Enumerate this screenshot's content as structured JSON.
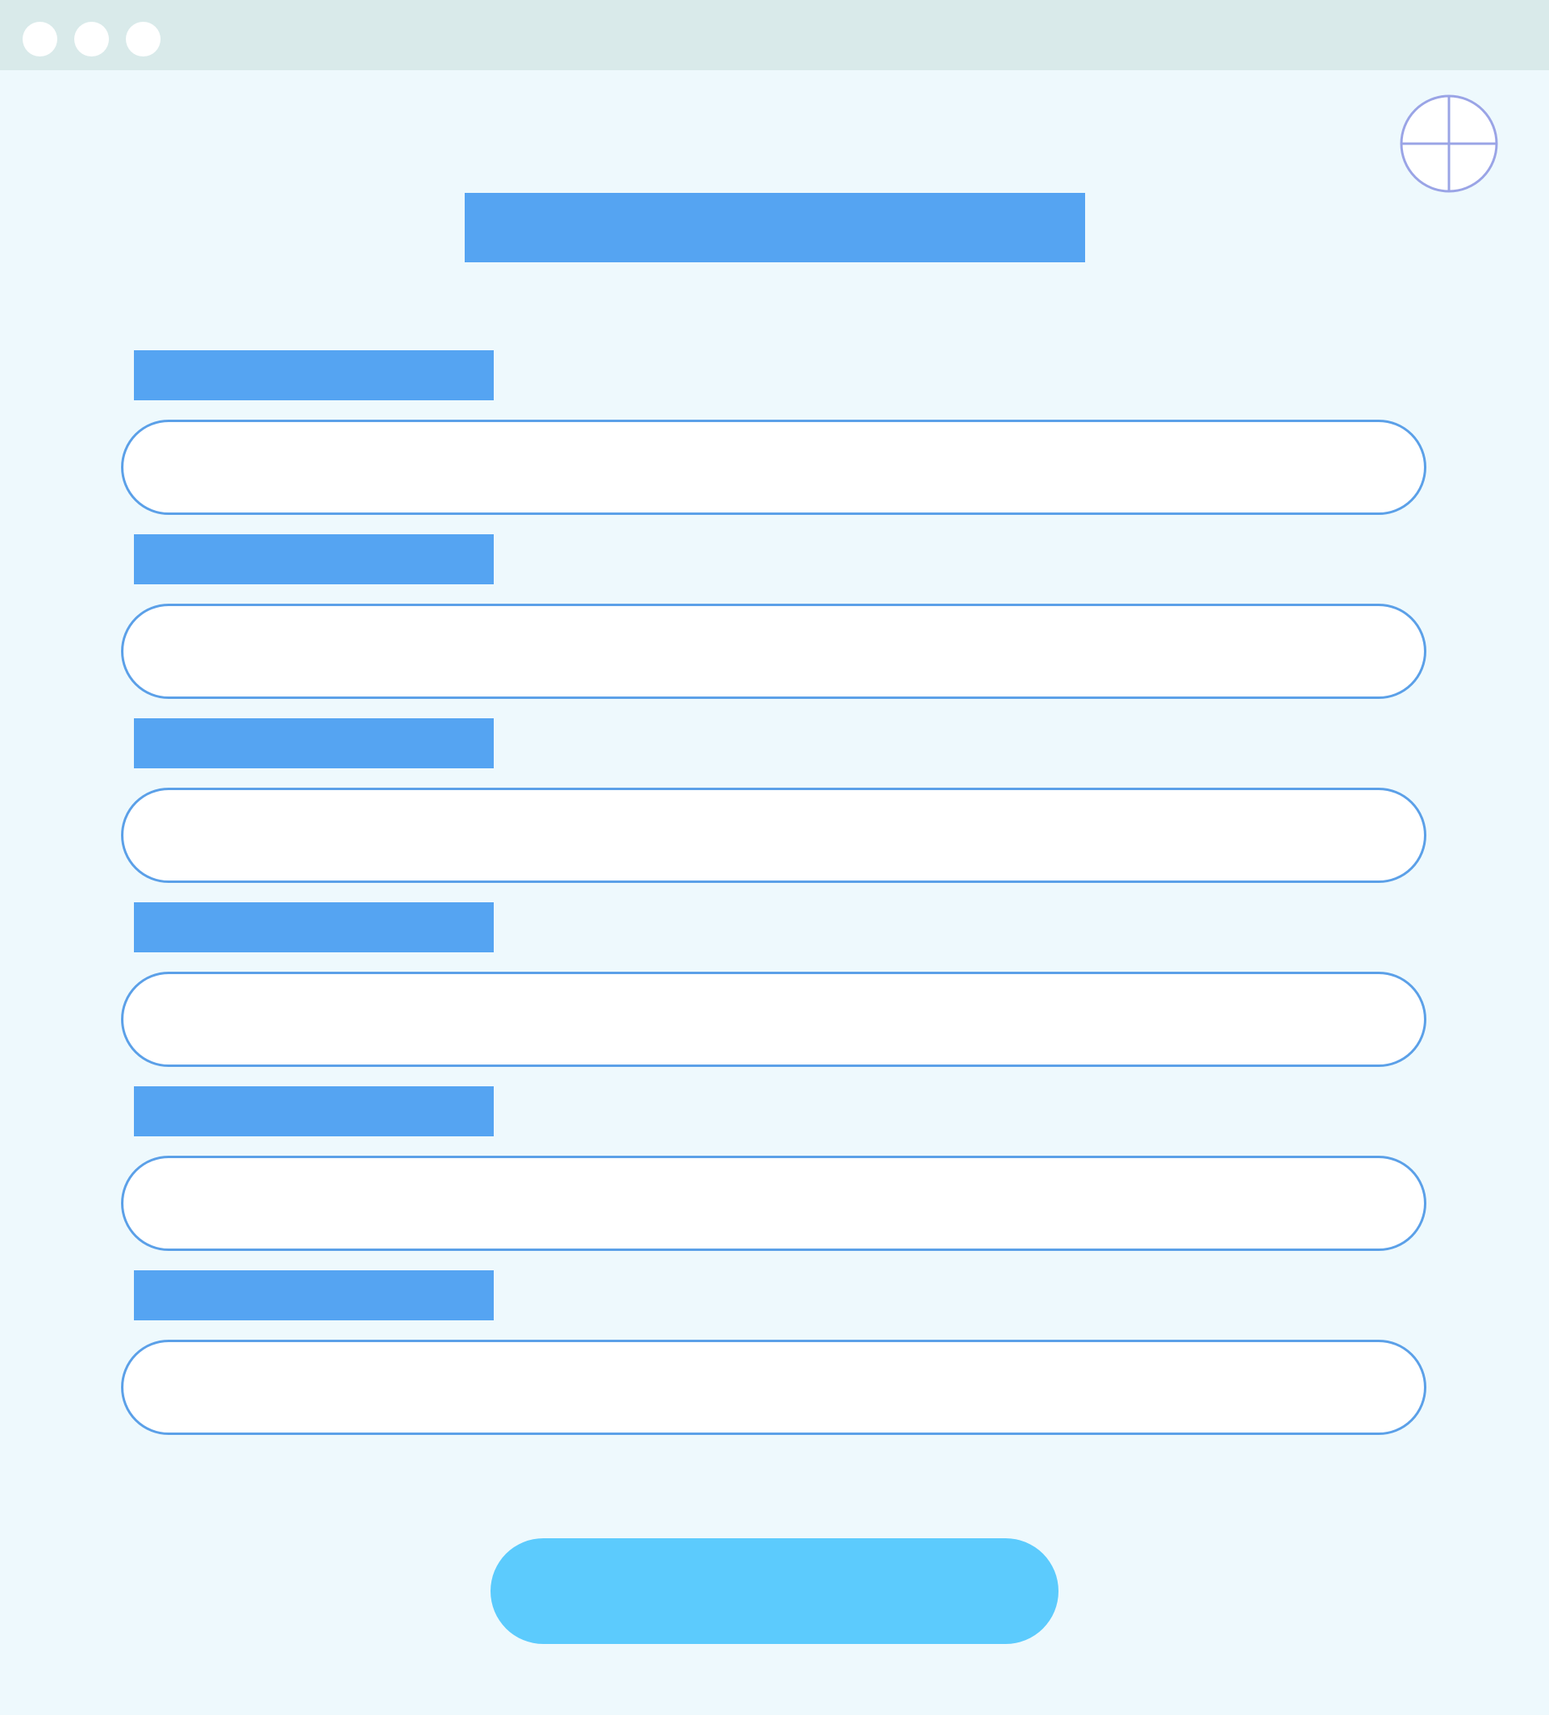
{
  "window": {
    "controls": [
      "close",
      "minimize",
      "maximize"
    ]
  },
  "header": {
    "language_icon": "globe-icon",
    "title": ""
  },
  "form": {
    "fields": [
      {
        "label": "",
        "value": "",
        "placeholder": ""
      },
      {
        "label": "",
        "value": "",
        "placeholder": ""
      },
      {
        "label": "",
        "value": "",
        "placeholder": ""
      },
      {
        "label": "",
        "value": "",
        "placeholder": ""
      },
      {
        "label": "",
        "value": "",
        "placeholder": ""
      },
      {
        "label": "",
        "value": "",
        "placeholder": ""
      }
    ],
    "submit_label": ""
  },
  "colors": {
    "page_background": "#eef9fd",
    "titlebar": "#d9eaea",
    "placeholder_blocks": "#55a4f2",
    "input_border": "#5ba0e8",
    "submit_button": "#5ccbfd",
    "globe_icon": "#9aa4e6"
  }
}
